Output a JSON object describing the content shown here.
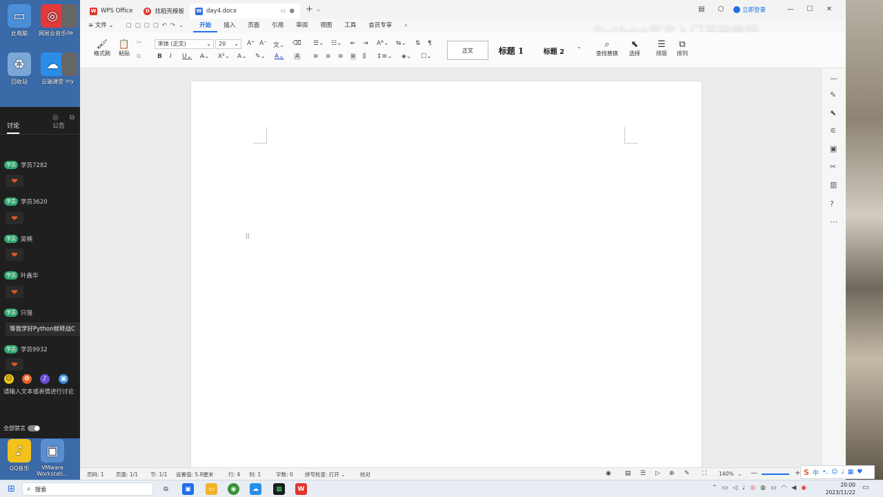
{
  "desktop": {
    "icons": [
      {
        "label": "此电脑",
        "icon": "computer-icon",
        "color": "#4a8fd8"
      },
      {
        "label": "网易云音乐",
        "icon": "music-icon",
        "color": "#e03a3a"
      },
      {
        "label": "de",
        "icon": "app-icon",
        "color": "#666666"
      },
      {
        "label": "回收站",
        "icon": "recycle-bin-icon",
        "color": "#7aa7d6"
      },
      {
        "label": "云端课堂",
        "icon": "cloud-class-icon",
        "color": "#2a8ee8"
      },
      {
        "label": "my",
        "icon": "app-icon",
        "color": "#666666"
      },
      {
        "label": "QQ音乐",
        "icon": "qq-music-icon",
        "color": "#f2c21b"
      },
      {
        "label": "VMware Workstati...",
        "icon": "vmware-icon",
        "color": "#5a8fcf"
      }
    ]
  },
  "chat": {
    "tabs": [
      "讨论",
      "公告"
    ],
    "messages": [
      {
        "badge": "学员",
        "name": "学员7282",
        "kind": "gift"
      },
      {
        "badge": "学员",
        "name": "学员3620",
        "kind": "gift"
      },
      {
        "badge": "学员",
        "name": "吴楠",
        "kind": "gift"
      },
      {
        "badge": "学员",
        "name": "叶鑫华",
        "kind": "gift"
      },
      {
        "badge": "学员",
        "name": "只强",
        "text": "等我学好Python就转战C"
      },
      {
        "badge": "学员",
        "name": "学员9932",
        "kind": "gift"
      }
    ],
    "input_placeholder": "请输入文本或表情进行讨论",
    "mute_all": "全部禁言"
  },
  "titlebar": {
    "tabs": [
      {
        "label": "WPS Office",
        "icon": "wps-icon",
        "active": false
      },
      {
        "label": "找稻壳模板",
        "icon": "template-icon",
        "active": false
      },
      {
        "label": "day4.docx",
        "icon": "word-doc-icon",
        "active": true
      }
    ],
    "login": "立即登录"
  },
  "menubar": {
    "file": "文件",
    "items": [
      "开始",
      "插入",
      "页面",
      "引用",
      "审阅",
      "视图",
      "工具",
      "会员专享"
    ],
    "active": "开始"
  },
  "ribbon": {
    "format_painter": "格式刷",
    "paste": "粘贴",
    "font": "宋体 (正文)",
    "size": "20",
    "styles": [
      "正文",
      "标题 1",
      "标题 2"
    ],
    "find_replace": "查找替换",
    "select": "选择",
    "layout": "排版",
    "arrange": "排列"
  },
  "watermark": "Python官方入门基础教程",
  "status": {
    "page_num": "页码: 1",
    "pages": "页面: 1/1",
    "section": "节: 1/1",
    "setting": "设置值: 5.8厘米",
    "row": "行: 4",
    "col": "列: 1",
    "words": "字数: 0",
    "spell": "拼写检查: 打开",
    "proof": "校对",
    "zoom": "140%"
  },
  "taskbar": {
    "search": "搜索",
    "time": "20:00",
    "date": "2023/11/22",
    "ime": "中"
  },
  "colors": {
    "accent": "#1f6fe8",
    "wps_red": "#e0342c",
    "chat_bg": "#1f1f1f",
    "badge": "#2ea56c"
  }
}
